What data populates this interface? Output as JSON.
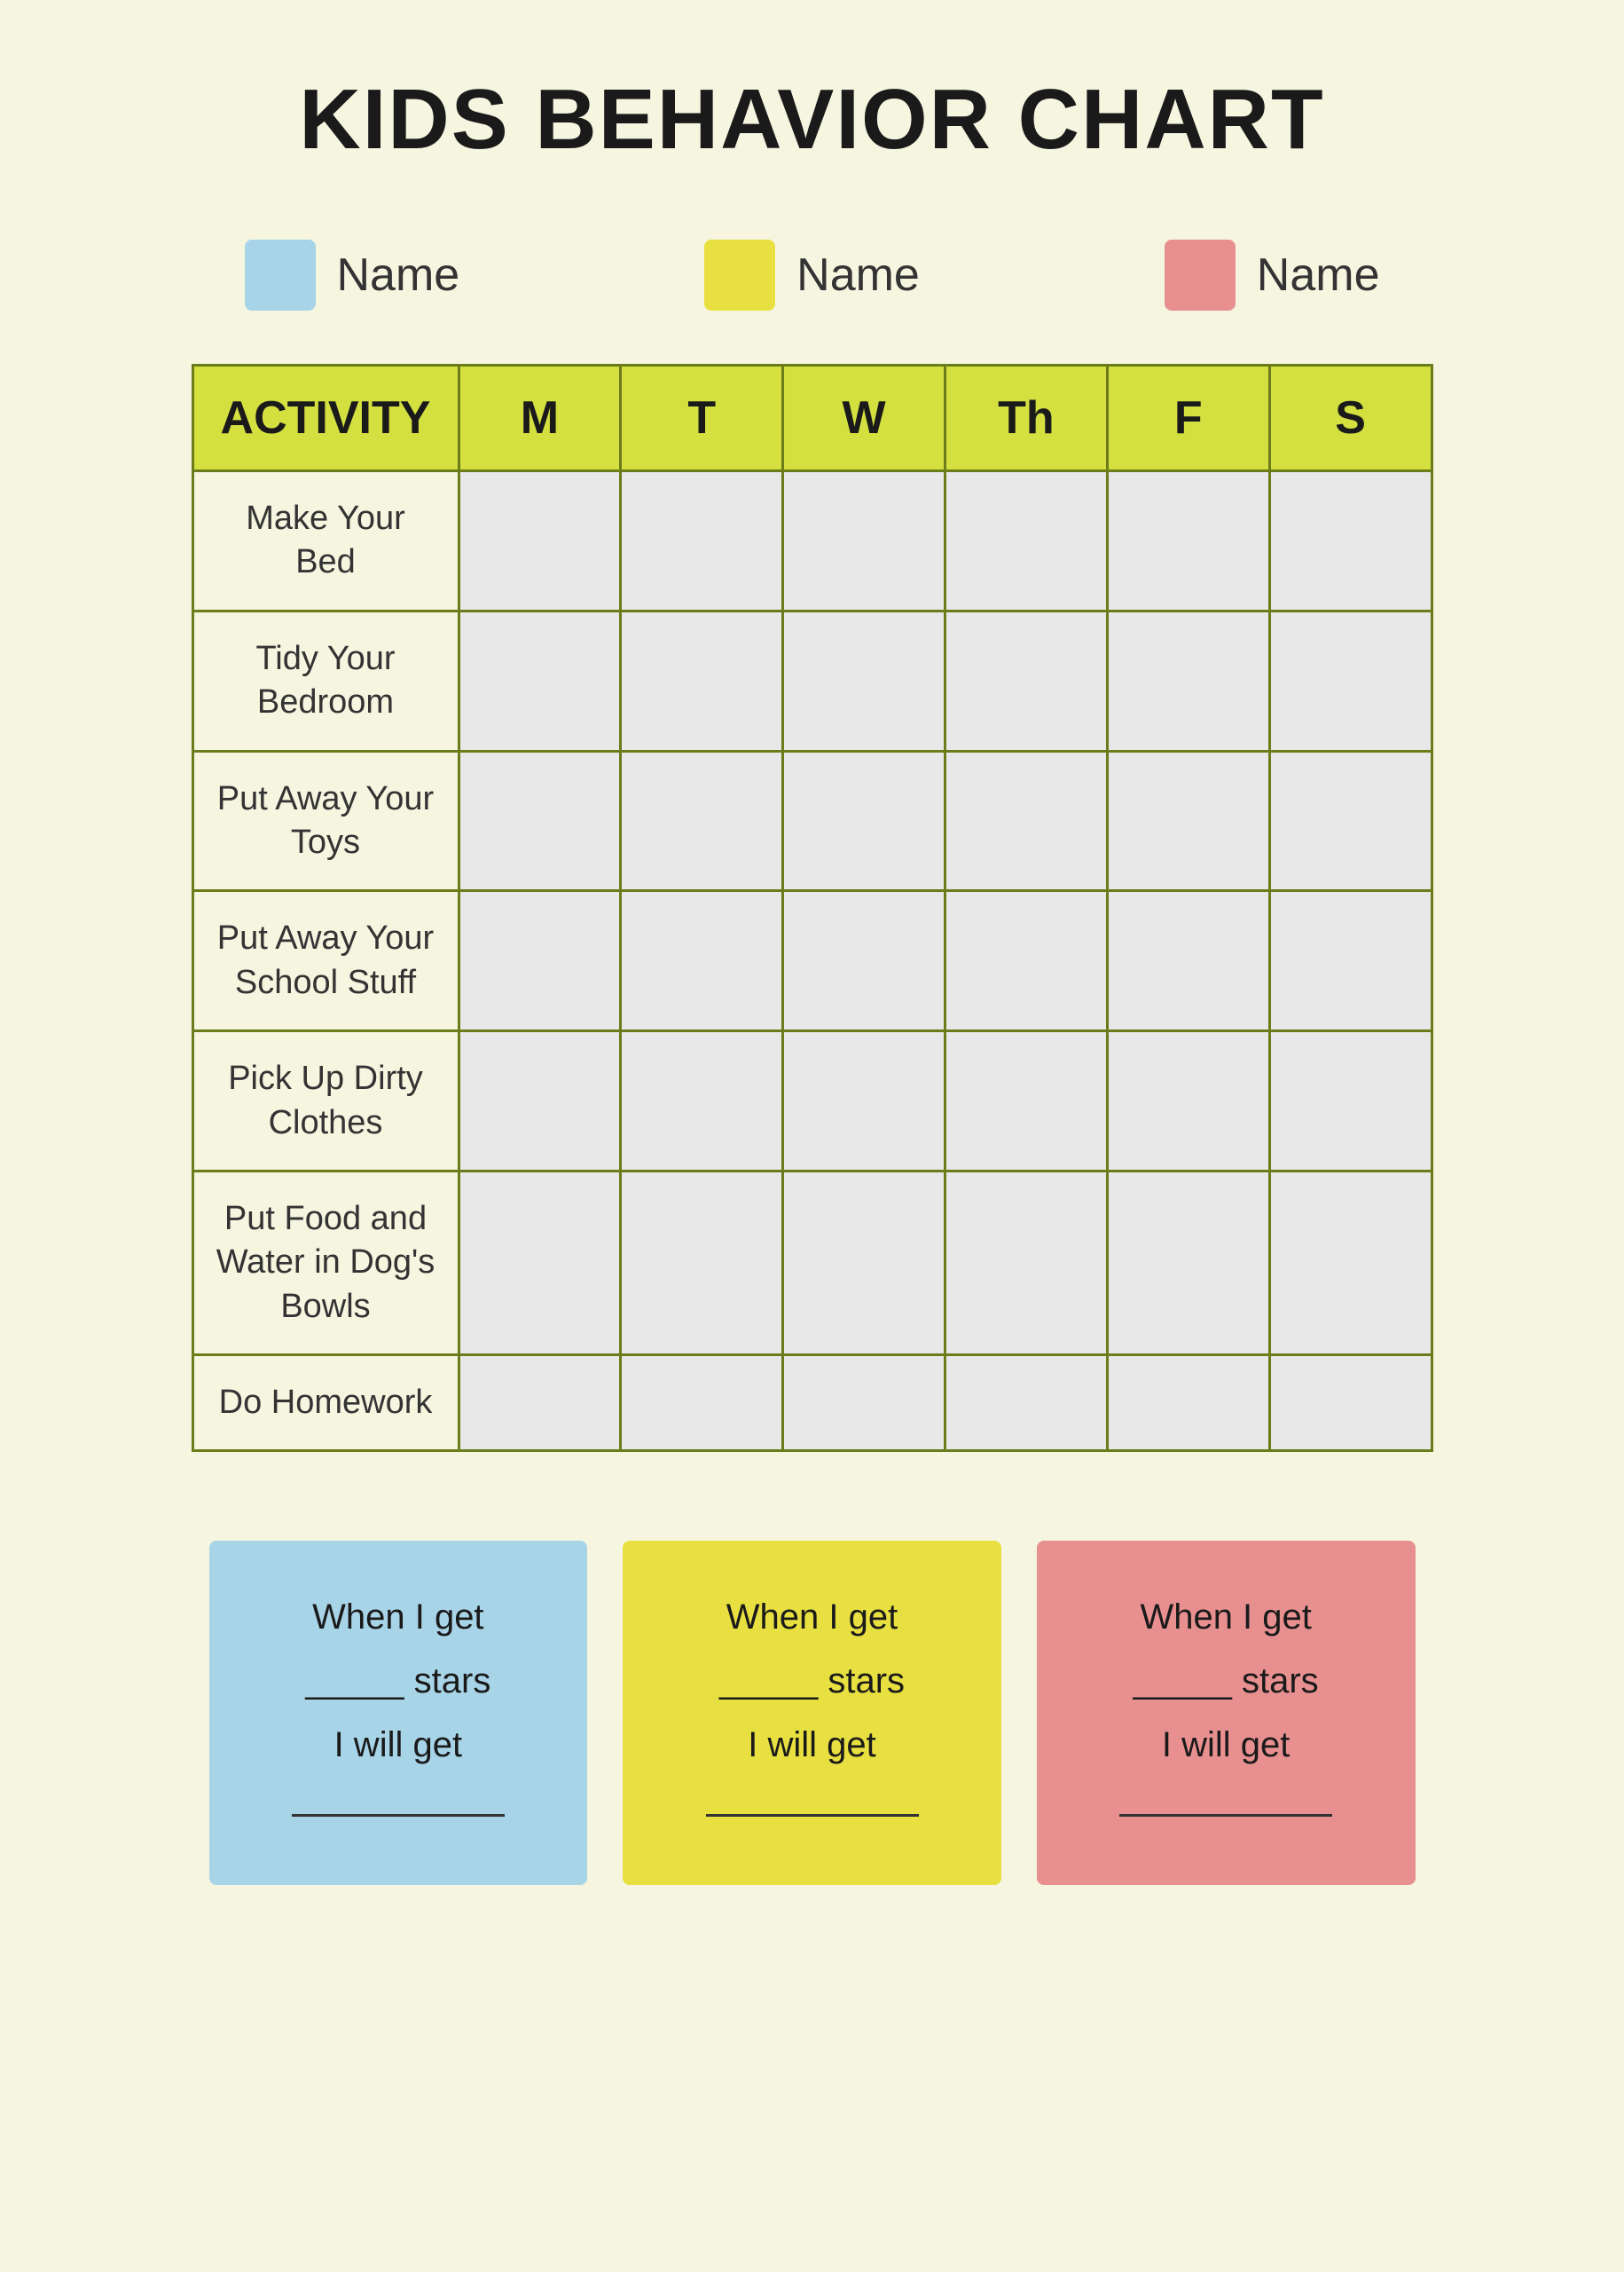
{
  "title": "KIDS BEHAVIOR CHART",
  "legend": {
    "items": [
      {
        "id": "blue",
        "color": "#a8d4e8",
        "label": "Name"
      },
      {
        "id": "yellow",
        "color": "#e8e040",
        "label": "Name"
      },
      {
        "id": "pink",
        "color": "#e89090",
        "label": "Name"
      }
    ]
  },
  "table": {
    "headers": {
      "activity": "ACTIVITY",
      "days": [
        "M",
        "T",
        "W",
        "Th",
        "F",
        "S"
      ]
    },
    "rows": [
      {
        "activity": "Make Your Bed"
      },
      {
        "activity": "Tidy Your Bedroom"
      },
      {
        "activity": "Put Away Your Toys"
      },
      {
        "activity": "Put Away Your School Stuff"
      },
      {
        "activity": "Pick Up Dirty Clothes"
      },
      {
        "activity": "Put Food and Water in Dog's Bowls"
      },
      {
        "activity": "Do Homework"
      }
    ]
  },
  "rewards": [
    {
      "id": "blue",
      "color": "#a8d4e8",
      "line1": "When I get",
      "line2": "_____ stars",
      "line3": "I will get",
      "line4": ""
    },
    {
      "id": "yellow",
      "color": "#e8e040",
      "line1": "When I get",
      "line2": "_____ stars",
      "line3": "I will get",
      "line4": ""
    },
    {
      "id": "pink",
      "color": "#e89090",
      "line1": "When I get",
      "line2": "_____ stars",
      "line3": "I will get",
      "line4": ""
    }
  ]
}
